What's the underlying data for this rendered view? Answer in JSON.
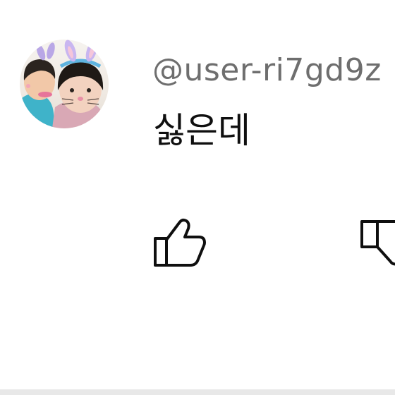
{
  "comment": {
    "username": "@user-ri7gd9z",
    "text": "싫은데",
    "avatar_icon": "profile-photo-icon"
  },
  "actions": {
    "like_icon": "thumbs-up-icon",
    "dislike_icon": "thumbs-down-icon"
  },
  "colors": {
    "username": "#6e6e6e",
    "text": "#0f0f0f",
    "icon_stroke": "#0f0f0f",
    "divider": "#e8e8e8"
  }
}
